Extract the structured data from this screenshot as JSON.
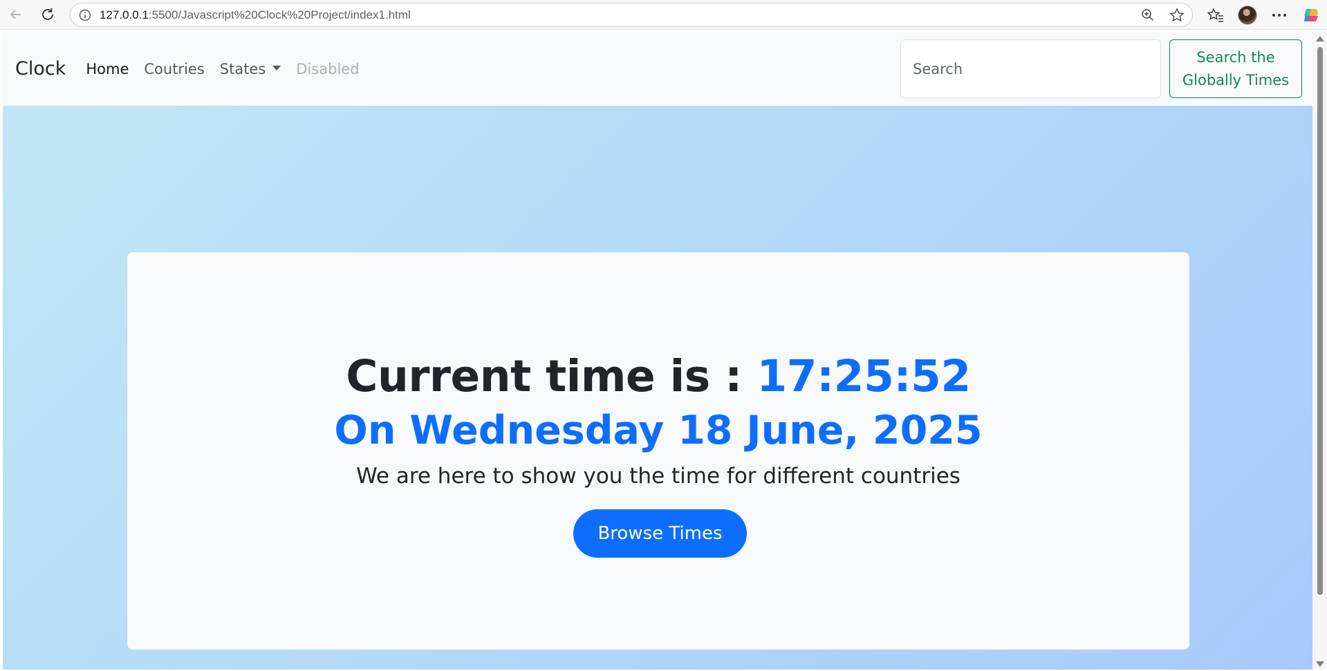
{
  "browser": {
    "url_host": "127.0.0.1",
    "url_rest": ":5500/Javascript%20Clock%20Project/index1.html",
    "icons": [
      "back-arrow-icon",
      "reload-icon",
      "info-icon",
      "zoom-icon",
      "star-icon",
      "favorites-icon",
      "profile-avatar",
      "more-icon",
      "copilot-icon"
    ]
  },
  "navbar": {
    "brand": "Clock",
    "links": [
      {
        "label": "Home",
        "state": "active"
      },
      {
        "label": "Coutries",
        "state": "normal"
      },
      {
        "label": "States",
        "state": "dropdown"
      },
      {
        "label": "Disabled",
        "state": "disabled"
      }
    ],
    "search_placeholder": "Search",
    "search_button_line1": "Search the",
    "search_button_line2": "Globally Times"
  },
  "hero": {
    "headline_prefix": "Current time is : ",
    "time": "17:25:52",
    "date": "On Wednesday 18 June, 2025",
    "tagline": "We are here to show you the time for different countries",
    "cta": "Browse Times"
  },
  "colors": {
    "primary": "#0d6efd",
    "success": "#198754",
    "navbar_bg": "#f8f9fa",
    "gradient_start": "#c0e6f6",
    "gradient_end": "#a9c9fb"
  }
}
